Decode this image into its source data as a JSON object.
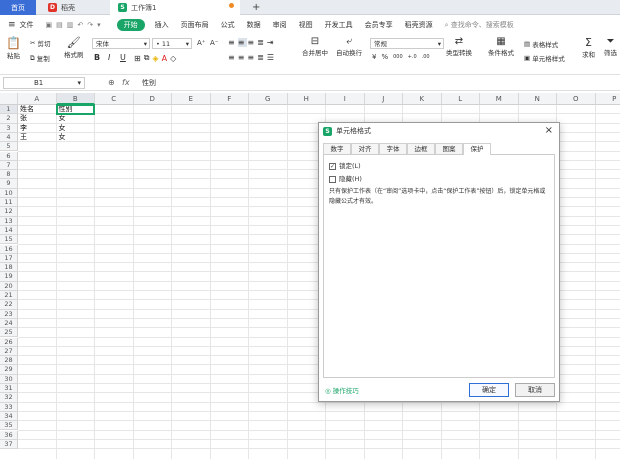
{
  "tabs": {
    "home": "首页",
    "shell": "稻壳",
    "book": "工作簿1",
    "plus": "+"
  },
  "menu": [
    "文件",
    "开始",
    "插入",
    "页面布局",
    "公式",
    "数据",
    "审阅",
    "视图",
    "开发工具",
    "会员专享",
    "稻壳资源"
  ],
  "menu_icon": "≡",
  "search_placeholder": "查找命令、搜索模板",
  "ribbon": {
    "paste": "粘贴",
    "cut": "剪切",
    "copy": "复制",
    "format_painter": "格式刷",
    "font": "宋体",
    "size": "11",
    "inc": "A⁺",
    "dec": "A⁻",
    "bold": "B",
    "italic": "I",
    "underline": "U",
    "merge": "合并居中",
    "wrap": "自动换行",
    "numfmt": "常规",
    "yuan": "¥",
    "pct": "%",
    "thou": "000",
    "dec1": "+.0",
    "dec2": ".00",
    "type_convert": "类型转换",
    "cond_format": "条件格式",
    "table_style": "表格样式",
    "cell_style": "单元格样式",
    "sum": "求和",
    "filter": "筛选"
  },
  "formula_bar": {
    "cell_ref": "B1",
    "fx": "fx",
    "content": "性别"
  },
  "columns": [
    "A",
    "B",
    "C",
    "D",
    "E",
    "F",
    "G",
    "H",
    "I",
    "J",
    "K",
    "L",
    "M",
    "N",
    "O",
    "P"
  ],
  "rows": [
    "1",
    "2",
    "3",
    "4",
    "5",
    "6",
    "7",
    "8",
    "9",
    "10",
    "11",
    "12",
    "13",
    "14",
    "15",
    "16",
    "17",
    "18",
    "19",
    "20",
    "21",
    "22",
    "23",
    "24",
    "25",
    "26",
    "27",
    "28",
    "29",
    "30",
    "31",
    "32",
    "33",
    "34",
    "35",
    "36",
    "37"
  ],
  "cells": {
    "a1": "姓名",
    "b1": "性别",
    "a2": "张",
    "b2": "女",
    "a3": "李",
    "b3": "女",
    "a4": "王",
    "b4": "女"
  },
  "dialog": {
    "title": "单元格格式",
    "close": "×",
    "tabs": [
      "数字",
      "对齐",
      "字体",
      "边框",
      "图案",
      "保护"
    ],
    "active_tab": "保护",
    "locked_label": "锁定(L)",
    "locked_checked": true,
    "hidden_label": "隐藏(H)",
    "hidden_checked": false,
    "note": "只有保护工作表（在“审阅”选项卡中，点击“保护工作表”按钮）后，锁定单元格或隐藏公式才有效。",
    "tips": "操作技巧",
    "ok": "确定",
    "cancel": "取消"
  },
  "colors": {
    "accent": "#1aa568",
    "home_tab": "#3b6dd6",
    "selection": "#1aa568"
  }
}
